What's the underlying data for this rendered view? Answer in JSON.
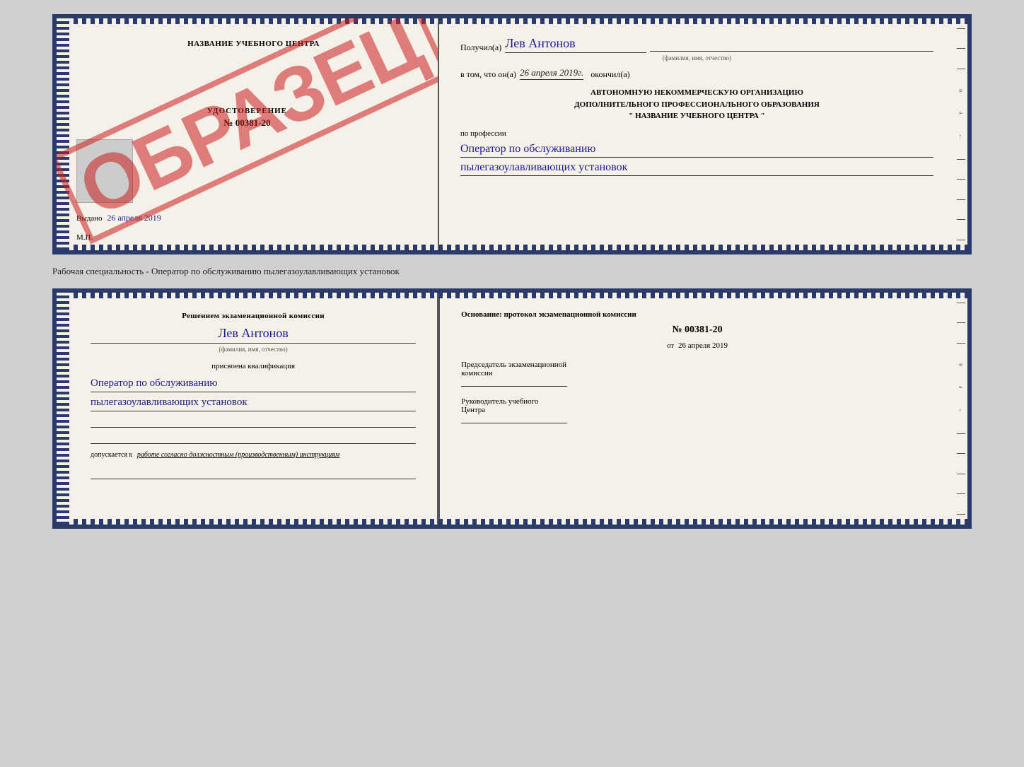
{
  "top_cert": {
    "left": {
      "school_name": "НАЗВАНИЕ УЧЕБНОГО ЦЕНТРА",
      "obrazets": "ОБРАЗЕЦ",
      "udostoverenie_title": "УДОСТОВЕРЕНИЕ",
      "udostoverenie_num": "№ 00381-20",
      "vydano_label": "Выдано",
      "vydano_date": "26 апреля 2019",
      "mp": "М.П."
    },
    "right": {
      "poluchil_label": "Получил(а)",
      "poluchil_name": "Лев Антонов",
      "fio_subtitle": "(фамилия, имя, отчество)",
      "dash": "–",
      "vtom_label": "в том, что он(а)",
      "vtom_date": "26 апреля 2019г.",
      "okonchil_label": "окончил(а)",
      "org_line1": "АВТОНОМНУЮ НЕКОММЕРЧЕСКУЮ ОРГАНИЗАЦИЮ",
      "org_line2": "ДОПОЛНИТЕЛЬНОГО ПРОФЕССИОНАЛЬНОГО ОБРАЗОВАНИЯ",
      "org_line3": "\" НАЗВАНИЕ УЧЕБНОГО ЦЕНТРА \"",
      "po_professii": "по профессии",
      "profession_line1": "Оператор по обслуживанию",
      "profession_line2": "пылегазоулавливающих установок"
    }
  },
  "middle_label": "Рабочая специальность - Оператор по обслуживанию пылегазоулавливающих установок",
  "bottom_cert": {
    "left": {
      "resheniem_label": "Решением экзаменационной комиссии",
      "person_name": "Лев Антонов",
      "fio_subtitle": "(фамилия, имя, отчество)",
      "prisvoena_label": "присвоена квалификация",
      "qualification_line1": "Оператор по обслуживанию",
      "qualification_line2": "пылегазоулавливающих установок",
      "dopuskaetsya_label": "допускается к",
      "dopuskaetsya_text": "работе согласно должностным (производственным) инструкциям"
    },
    "right": {
      "osnovanie_label": "Основание: протокол экзаменационной комиссии",
      "protocol_num": "№ 00381-20",
      "ot_label": "от",
      "ot_date": "26 апреля 2019",
      "predsedatel_label": "Председатель экзаменационной",
      "komissii_label": "комиссии",
      "rukovoditel_label": "Руководитель учебного",
      "tsentra_label": "Центра"
    }
  }
}
